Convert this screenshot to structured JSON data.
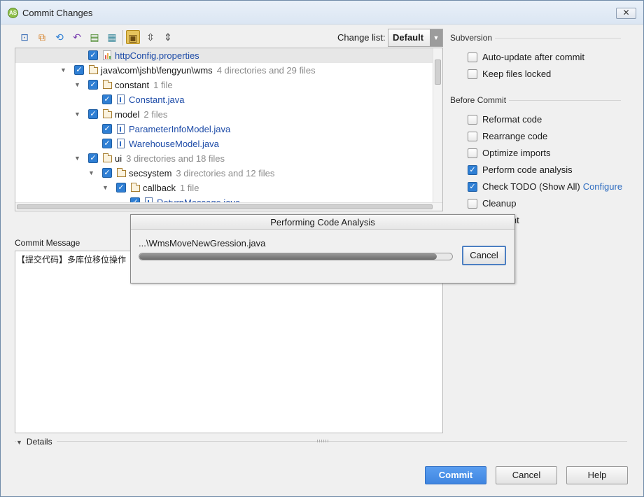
{
  "window": {
    "title": "Commit Changes",
    "close_glyph": "✕"
  },
  "toolbar": {
    "icons": [
      "refresh-changes-icon",
      "move-to-changelist-icon",
      "sync-icon",
      "revert-icon",
      "show-diff-icon",
      "group-by-icon",
      "show-directories-icon",
      "expand-all-icon",
      "collapse-all-icon"
    ],
    "changelist_label": "Change list:",
    "changelist_value": "Default"
  },
  "tree": {
    "rows": [
      {
        "name": "httpConfig.properties",
        "hint": "",
        "kind": "prop",
        "checked": true,
        "expander": "",
        "selected": true
      },
      {
        "name": "java\\com\\jshb\\fengyun\\wms",
        "hint": "4 directories and 29 files",
        "kind": "folder",
        "checked": true,
        "expander": "▼"
      },
      {
        "name": "constant",
        "hint": "1 file",
        "kind": "folder",
        "checked": true,
        "expander": "▼"
      },
      {
        "name": "Constant.java",
        "hint": "",
        "kind": "file",
        "checked": true,
        "expander": ""
      },
      {
        "name": "model",
        "hint": "2 files",
        "kind": "folder",
        "checked": true,
        "expander": "▼"
      },
      {
        "name": "ParameterInfoModel.java",
        "hint": "",
        "kind": "file",
        "checked": true,
        "expander": ""
      },
      {
        "name": "WarehouseModel.java",
        "hint": "",
        "kind": "file",
        "checked": true,
        "expander": ""
      },
      {
        "name": "ui",
        "hint": "3 directories and 18 files",
        "kind": "folder",
        "checked": true,
        "expander": "▼"
      },
      {
        "name": "secsystem",
        "hint": "3 directories and 12 files",
        "kind": "folder",
        "checked": true,
        "expander": "▼"
      },
      {
        "name": "callback",
        "hint": "1 file",
        "kind": "folder",
        "checked": true,
        "expander": "▼"
      },
      {
        "name": "ReturnMessage.java",
        "hint": "",
        "kind": "file",
        "checked": true,
        "expander": ""
      }
    ]
  },
  "commit_message": {
    "label": "Commit Message",
    "value": "【提交代码】多库位移位操作"
  },
  "subversion": {
    "title": "Subversion",
    "options": [
      {
        "label": "Auto-update after commit",
        "checked": false
      },
      {
        "label": "Keep files locked",
        "checked": false
      }
    ]
  },
  "before_commit": {
    "title": "Before Commit",
    "options": [
      {
        "label": "Reformat code",
        "checked": false,
        "link": ""
      },
      {
        "label": "Rearrange code",
        "checked": false,
        "link": ""
      },
      {
        "label": "Optimize imports",
        "checked": false,
        "link": ""
      },
      {
        "label": "Perform code analysis",
        "checked": true,
        "link": ""
      },
      {
        "label": "Check TODO (Show All)",
        "checked": true,
        "link": "Configure"
      },
      {
        "label": "Cleanup",
        "checked": false,
        "link": ""
      },
      {
        "label": "copyright",
        "checked": false,
        "link": ""
      }
    ]
  },
  "details": {
    "label": "Details"
  },
  "buttons": {
    "commit": "Commit",
    "cancel": "Cancel",
    "help": "Help"
  },
  "modal": {
    "title": "Performing Code Analysis",
    "file": "...\\WmsMoveNewGression.java",
    "progress": 0.95,
    "cancel": "Cancel"
  },
  "colors": {
    "accent": "#3f85e0",
    "checkbox": "#2f7fd4",
    "file_link": "#1e4ca8"
  }
}
